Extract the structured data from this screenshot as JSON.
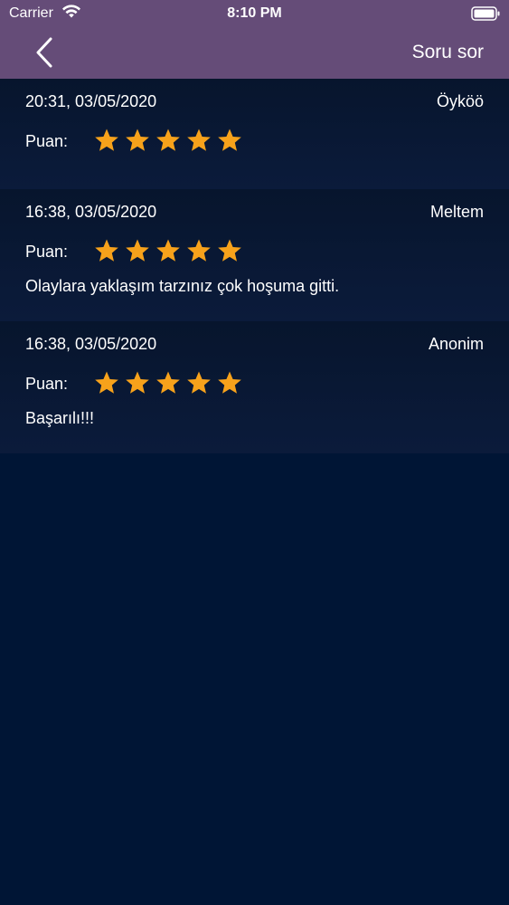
{
  "status_bar": {
    "carrier": "Carrier",
    "time": "8:10 PM"
  },
  "nav": {
    "action_label": "Soru sor"
  },
  "colors": {
    "nav_background": "#654c78",
    "content_background": "#001535",
    "star": "#f7a21b"
  },
  "reviews": [
    {
      "date": "20:31, 03/05/2020",
      "author": "Öyköö",
      "rating_label": "Puan:",
      "rating": 5,
      "comment": ""
    },
    {
      "date": "16:38, 03/05/2020",
      "author": "Meltem",
      "rating_label": "Puan:",
      "rating": 5,
      "comment": "Olaylara yaklaşım tarzınız çok hoşuma gitti."
    },
    {
      "date": "16:38, 03/05/2020",
      "author": "Anonim",
      "rating_label": "Puan:",
      "rating": 5,
      "comment": "Başarılı!!!"
    }
  ]
}
